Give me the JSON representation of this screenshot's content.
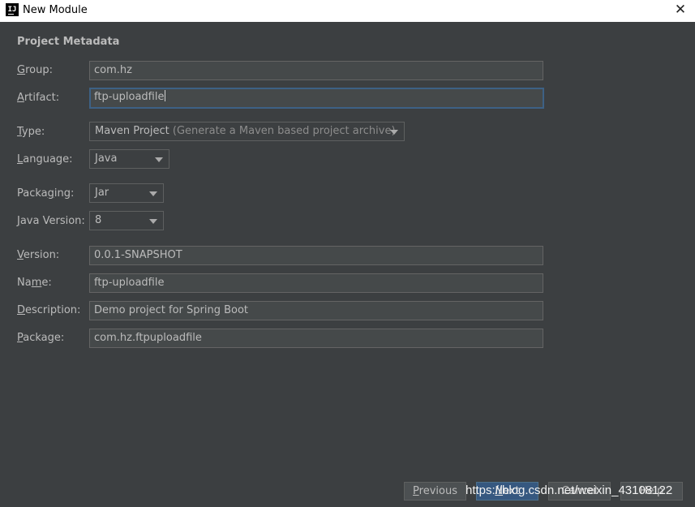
{
  "window": {
    "title": "New Module",
    "icon_text": "IJ"
  },
  "section": {
    "title": "Project Metadata"
  },
  "fields": {
    "group": {
      "label_m": "G",
      "label_rest": "roup:",
      "value": "com.hz"
    },
    "artifact": {
      "label_m": "A",
      "label_rest": "rtifact:",
      "value": "ftp-uploadfile"
    },
    "type": {
      "label_m": "T",
      "label_rest": "ype:",
      "value": "Maven Project",
      "hint": "(Generate a Maven based project archive)"
    },
    "language": {
      "label_m": "L",
      "label_rest": "anguage:",
      "value": "Java"
    },
    "packaging": {
      "label_pre": "Packa",
      "label_m": "g",
      "label_rest": "ing:",
      "value": "Jar"
    },
    "java_version": {
      "label_m": "J",
      "label_rest": "ava Version:",
      "value": "8"
    },
    "version": {
      "label_m": "V",
      "label_rest": "ersion:",
      "value": "0.0.1-SNAPSHOT"
    },
    "name": {
      "label_pre": "Na",
      "label_m": "m",
      "label_rest": "e:",
      "value": "ftp-uploadfile"
    },
    "description": {
      "label_m": "D",
      "label_rest": "escription:",
      "value": "Demo project for Spring Boot"
    },
    "package": {
      "label_m": "P",
      "label_rest": "ackage:",
      "value": "com.hz.ftpuploadfile"
    }
  },
  "buttons": {
    "previous": {
      "label_m": "P",
      "label_rest": "revious"
    },
    "next": {
      "label_m": "N",
      "label_rest": "ext"
    },
    "cancel": {
      "label": "Cancel"
    },
    "help": {
      "label": "Help"
    }
  },
  "watermark": "https://blog.csdn.net/weixin_43108122"
}
